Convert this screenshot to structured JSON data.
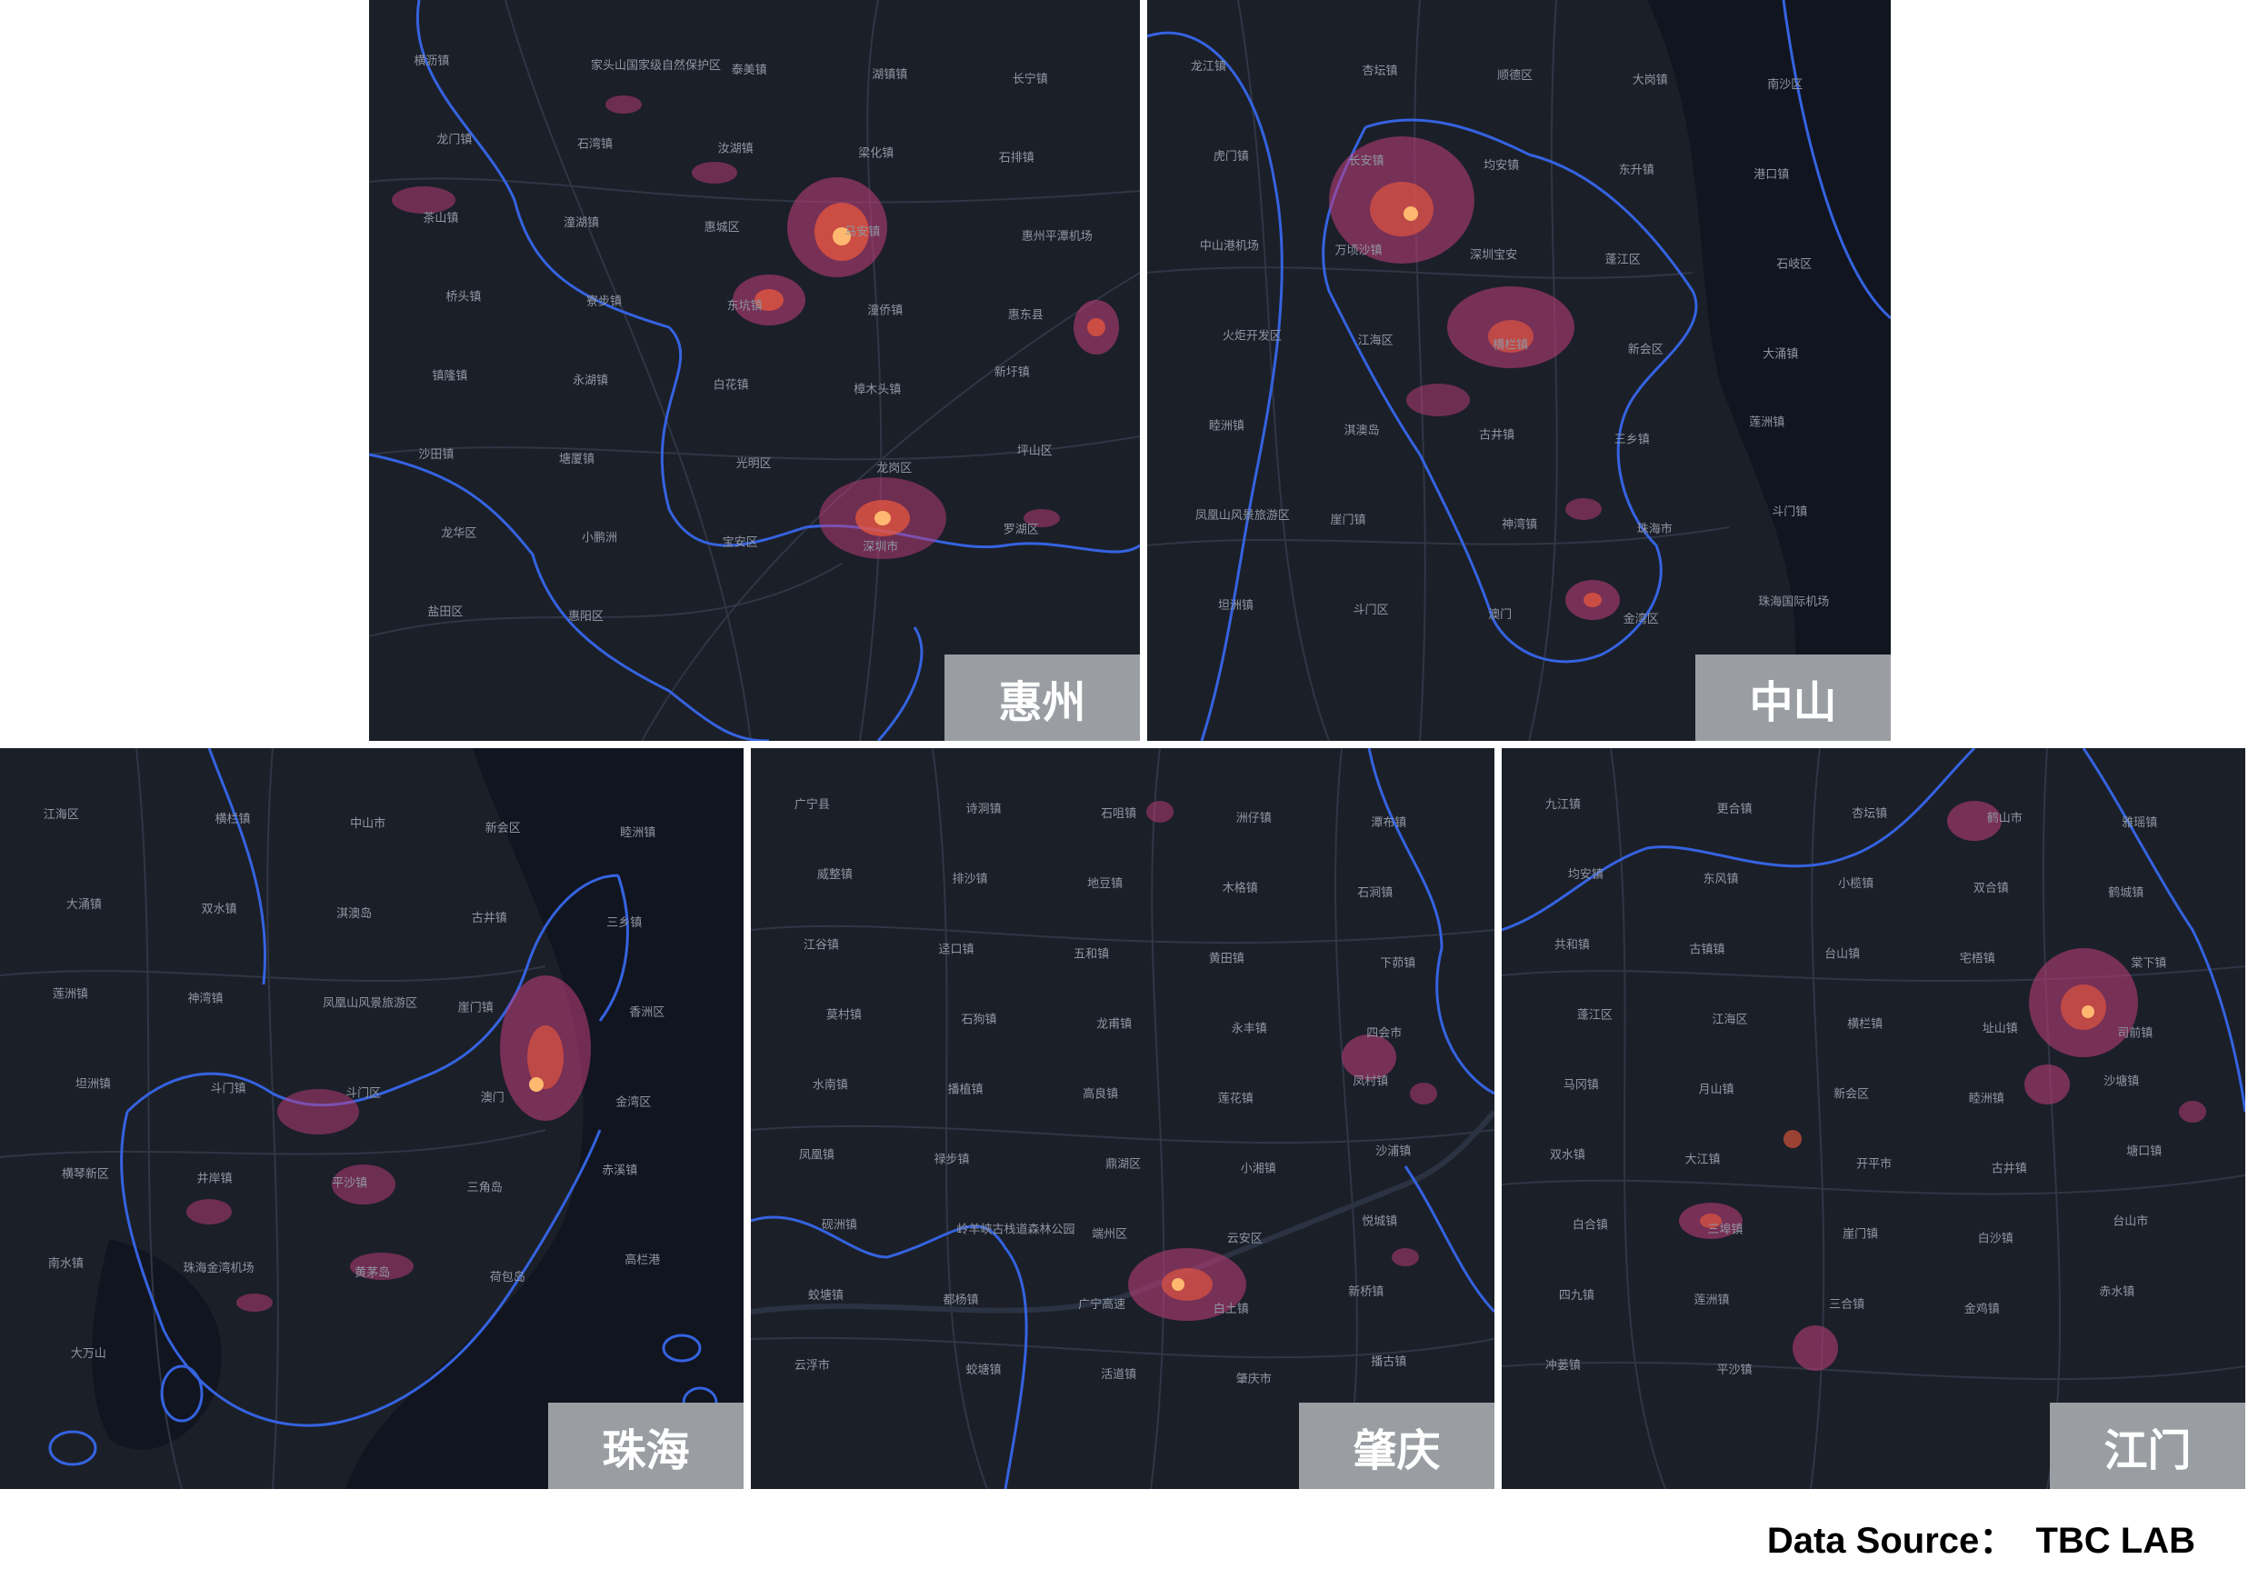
{
  "panels": [
    {
      "id": "huizhou",
      "city": "惠州",
      "places": [
        "横沥镇",
        "家头山国家级自然保护区",
        "泰美镇",
        "湖镇镇",
        "长宁镇",
        "龙门镇",
        "石湾镇",
        "汝湖镇",
        "梁化镇",
        "石排镇",
        "茶山镇",
        "潼湖镇",
        "惠城区",
        "马安镇",
        "惠州平潭机场",
        "桥头镇",
        "寮步镇",
        "东坑镇",
        "潼侨镇",
        "惠东县",
        "镇隆镇",
        "永湖镇",
        "白花镇",
        "樟木头镇",
        "新圩镇",
        "沙田镇",
        "塘厦镇",
        "光明区",
        "龙岗区",
        "坪山区",
        "龙华区",
        "小鹏洲",
        "宝安区",
        "深圳市",
        "罗湖区",
        "盐田区",
        "惠阳区"
      ]
    },
    {
      "id": "zhongshan",
      "city": "中山",
      "places": [
        "龙江镇",
        "杏坛镇",
        "顺德区",
        "大岗镇",
        "南沙区",
        "虎门镇",
        "长安镇",
        "均安镇",
        "东升镇",
        "港口镇",
        "中山港机场",
        "万顷沙镇",
        "深圳宝安",
        "蓬江区",
        "石岐区",
        "火炬开发区",
        "江海区",
        "横栏镇",
        "新会区",
        "大涌镇",
        "睦洲镇",
        "淇澳岛",
        "古井镇",
        "三乡镇",
        "莲洲镇",
        "凤凰山风景旅游区",
        "崖门镇",
        "神湾镇",
        "珠海市",
        "斗门镇",
        "坦洲镇",
        "斗门区",
        "澳门",
        "金湾区",
        "珠海国际机场"
      ]
    },
    {
      "id": "zhuhai",
      "city": "珠海",
      "places": [
        "江海区",
        "横栏镇",
        "中山市",
        "新会区",
        "睦洲镇",
        "大涌镇",
        "双水镇",
        "淇澳岛",
        "古井镇",
        "三乡镇",
        "莲洲镇",
        "神湾镇",
        "凤凰山风景旅游区",
        "崖门镇",
        "香洲区",
        "坦洲镇",
        "斗门镇",
        "斗门区",
        "澳门",
        "金湾区",
        "横琴新区",
        "井岸镇",
        "平沙镇",
        "三角岛",
        "赤溪镇",
        "南水镇",
        "珠海金湾机场",
        "黄茅岛",
        "荷包岛",
        "高栏港",
        "大万山"
      ]
    },
    {
      "id": "zhaoqing",
      "city": "肇庆",
      "places": [
        "广宁县",
        "诗洞镇",
        "石咀镇",
        "洲仔镇",
        "潭布镇",
        "威整镇",
        "排沙镇",
        "地豆镇",
        "木格镇",
        "石涧镇",
        "江谷镇",
        "迳口镇",
        "五和镇",
        "黄田镇",
        "下茆镇",
        "莫村镇",
        "石狗镇",
        "龙甫镇",
        "永丰镇",
        "四会市",
        "水南镇",
        "播植镇",
        "高良镇",
        "莲花镇",
        "凤村镇",
        "凤凰镇",
        "禄步镇",
        "鼎湖区",
        "小湘镇",
        "沙浦镇",
        "砚洲镇",
        "岭羊峡古栈道森林公园",
        "端州区",
        "云安区",
        "悦城镇",
        "蛟塘镇",
        "都杨镇",
        "广宁高速",
        "白土镇",
        "新桥镇",
        "云浮市",
        "蛟塘镇",
        "活道镇",
        "肇庆市",
        "播古镇"
      ]
    },
    {
      "id": "jiangmen",
      "city": "江门",
      "places": [
        "九江镇",
        "更合镇",
        "杏坛镇",
        "鹤山市",
        "雅瑶镇",
        "均安镇",
        "东风镇",
        "小榄镇",
        "双合镇",
        "鹤城镇",
        "共和镇",
        "古镇镇",
        "台山镇",
        "宅梧镇",
        "棠下镇",
        "蓬江区",
        "江海区",
        "横栏镇",
        "址山镇",
        "司前镇",
        "马冈镇",
        "月山镇",
        "新会区",
        "睦洲镇",
        "沙塘镇",
        "双水镇",
        "大江镇",
        "开平市",
        "古井镇",
        "塘口镇",
        "白合镇",
        "三埠镇",
        "崖门镇",
        "白沙镇",
        "台山市",
        "四九镇",
        "莲洲镇",
        "三合镇",
        "金鸡镇",
        "赤水镇",
        "冲蒌镇",
        "平沙镇"
      ]
    }
  ],
  "footer": {
    "source": "Data Source：  TBC LAB"
  },
  "colors": {
    "background": "#1b1f28",
    "border": "#3563e0",
    "road": "#2f3644",
    "heat_low": "#c23e7c",
    "heat_mid": "#f05a3c",
    "heat_high": "#ffb870",
    "label_box": "#9a9ea3"
  }
}
